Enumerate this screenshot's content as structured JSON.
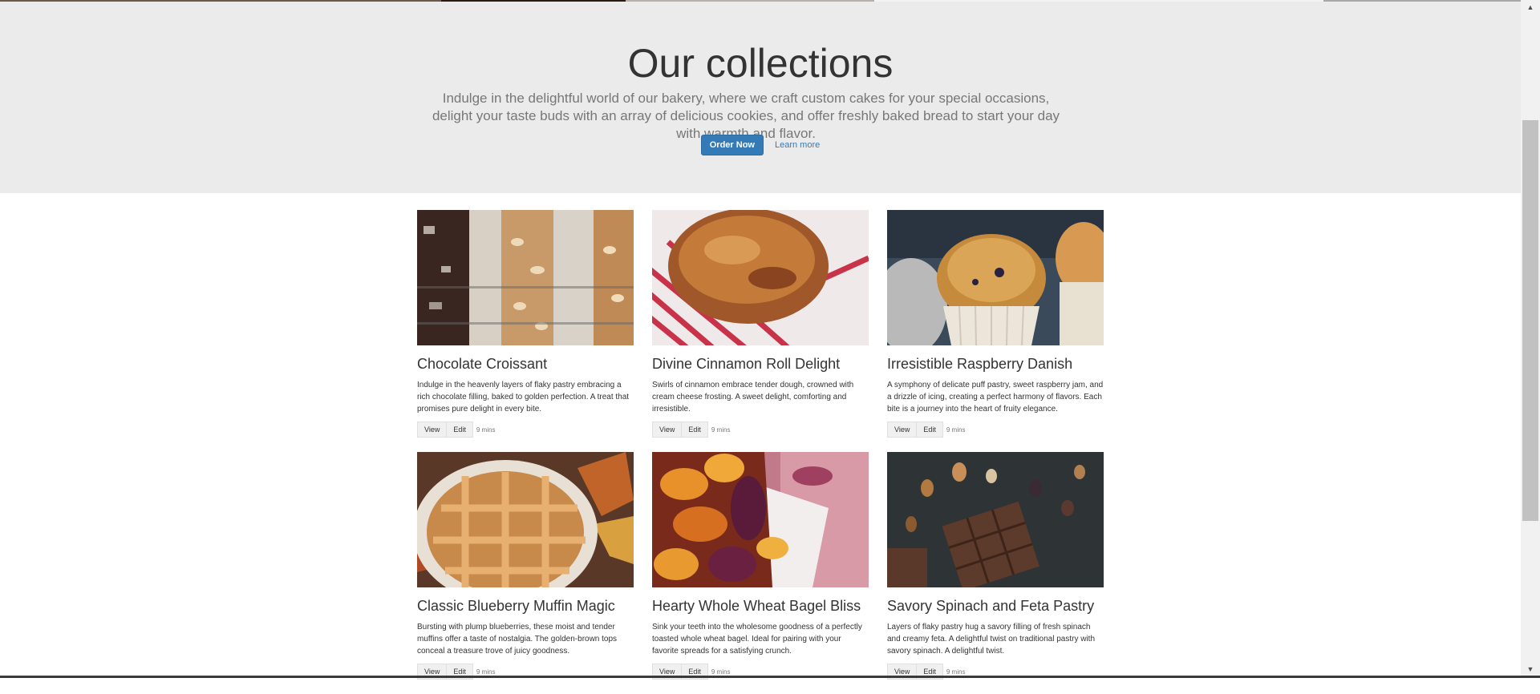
{
  "hero": {
    "title": "Our collections",
    "description": "Indulge in the delightful world of our bakery, where we craft custom cakes for your special occasions, delight your taste buds with an array of delicious cookies, and offer freshly baked bread to start your day with warmth and flavor.",
    "order_button": "Order Now",
    "learn_more": "Learn more"
  },
  "cards": [
    {
      "title": "Chocolate Croissant",
      "text": "Indulge in the heavenly layers of flaky pastry embracing a rich chocolate filling, baked to golden perfection. A treat that promises pure delight in every bite.",
      "view": "View",
      "edit": "Edit",
      "time": "9 mins"
    },
    {
      "title": "Divine Cinnamon Roll Delight",
      "text": "Swirls of cinnamon embrace tender dough, crowned with cream cheese frosting. A sweet delight, comforting and irresistible.",
      "view": "View",
      "edit": "Edit",
      "time": "9 mins"
    },
    {
      "title": "Irresistible Raspberry Danish",
      "text": "A symphony of delicate puff pastry, sweet raspberry jam, and a drizzle of icing, creating a perfect harmony of flavors. Each bite is a journey into the heart of fruity elegance.",
      "view": "View",
      "edit": "Edit",
      "time": "9 mins"
    },
    {
      "title": "Classic Blueberry Muffin Magic",
      "text": "Bursting with plump blueberries, these moist and tender muffins offer a taste of nostalgia. The golden-brown tops conceal a treasure trove of juicy goodness.",
      "view": "View",
      "edit": "Edit",
      "time": "9 mins"
    },
    {
      "title": "Hearty Whole Wheat Bagel Bliss",
      "text": "Sink your teeth into the wholesome goodness of a perfectly toasted whole wheat bagel. Ideal for pairing with your favorite spreads for a satisfying crunch.",
      "view": "View",
      "edit": "Edit",
      "time": "9 mins"
    },
    {
      "title": "Savory Spinach and Feta Pastry",
      "text": "Layers of flaky pastry hug a savory filling of fresh spinach and creamy feta. A delightful twist on traditional pastry with savory spinach. A delightful twist.",
      "view": "View",
      "edit": "Edit",
      "time": "9 mins"
    }
  ],
  "colors": {
    "hero_bg": "#ebebeb",
    "primary": "#337ab7",
    "muted_text": "#777777"
  }
}
